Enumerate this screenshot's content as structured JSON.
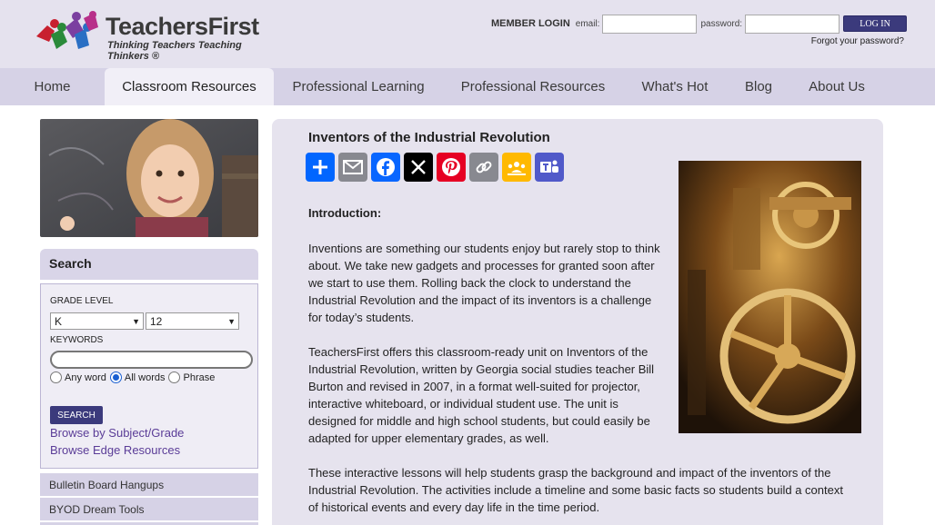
{
  "site": {
    "name": "TeachersFirst",
    "tagline": "Thinking Teachers Teaching Thinkers ®"
  },
  "login": {
    "title": "MEMBER LOGIN",
    "email_label": "email:",
    "password_label": "password:",
    "button_label": "LOG IN",
    "forgot_label": "Forgot your password?"
  },
  "nav": {
    "items": [
      "Home",
      "Classroom Resources",
      "Professional Learning",
      "Professional Resources",
      "What's Hot",
      "Blog",
      "About Us"
    ],
    "active": "Classroom Resources"
  },
  "search": {
    "heading": "Search",
    "grade_label": "GRADE LEVEL",
    "grade_from": "K",
    "grade_to": "12",
    "keywords_label": "KEYWORDS",
    "keywords_value": "",
    "options": [
      "Any word",
      "All words",
      "Phrase"
    ],
    "selected_option": "All words",
    "button_label": "SEARCH",
    "link_subject": "Browse by Subject/Grade",
    "link_edge": "Browse Edge Resources"
  },
  "sidebar": {
    "items": [
      "Bulletin Board Hangups",
      "BYOD Dream Tools"
    ]
  },
  "article": {
    "title": "Inventors of the Industrial Revolution",
    "share_icons": [
      "share-plus",
      "email",
      "facebook",
      "x",
      "pinterest",
      "copy-link",
      "google-classroom",
      "microsoft-teams"
    ],
    "intro_heading": "Introduction:",
    "paragraph1": "Inventions are something our students enjoy but rarely stop to think about.  We take new gadgets and processes for granted soon after we start to use them. Rolling back the clock to understand the Industrial Revolution and the impact of its inventors is a challenge for today’s students.",
    "paragraph2": "TeachersFirst offers this classroom-ready unit on Inventors of the Industrial Revolution, written by Georgia social studies teacher Bill Burton and revised in 2007, in a format well-suited for projector, interactive whiteboard, or individual student use. The unit is designed for middle and high school students, but could easily be adapted for upper elementary grades, as well.",
    "paragraph3": "These interactive lessons will help students grasp the background and impact of the inventors of the Industrial Revolution. The activities include a timeline and some basic facts so students build a context of historical events and every day life in the time period."
  },
  "colors": {
    "header_bg": "#e5e2ee",
    "nav_bg": "#d6d2e6",
    "button": "#3b3a7c",
    "link": "#5a3c97",
    "panel_bg": "#e6e3ee"
  }
}
